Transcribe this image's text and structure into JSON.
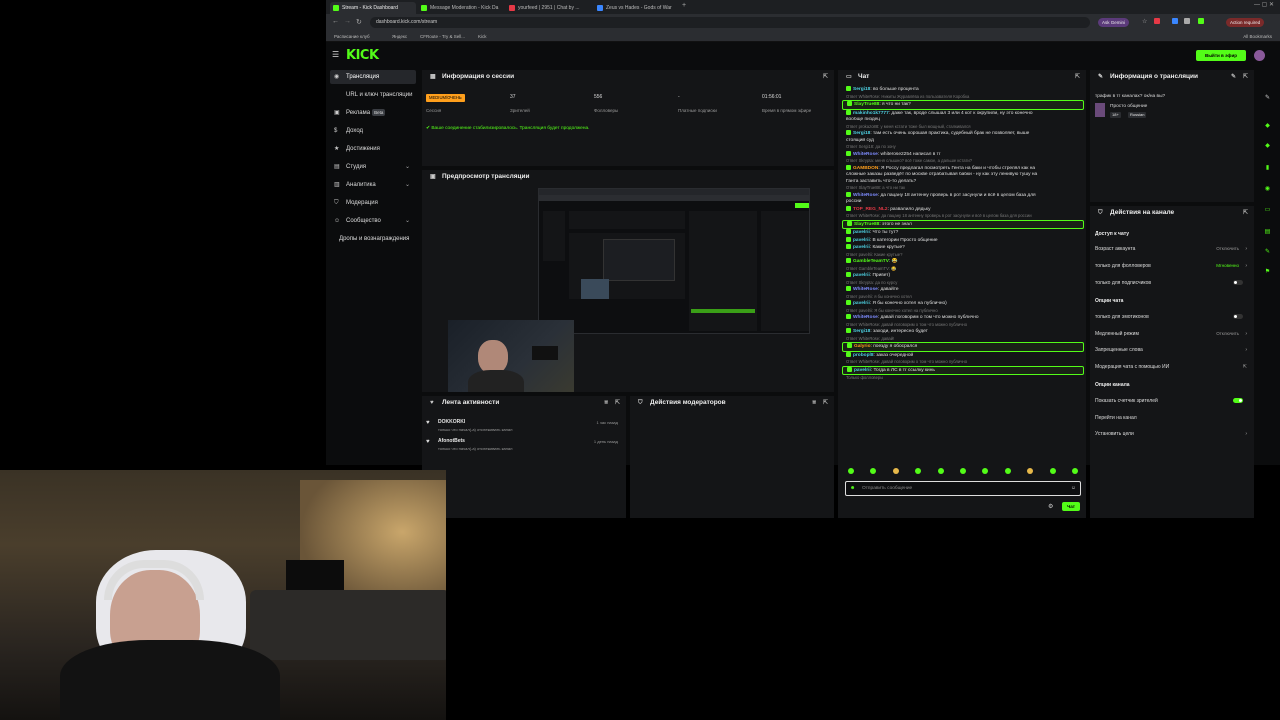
{
  "browser": {
    "tabs": [
      {
        "label": "Stream - Kick Dashboard",
        "color": "#53fc18",
        "active": true
      },
      {
        "label": "Message Moderation - Kick Da",
        "color": "#53fc18",
        "active": false
      },
      {
        "label": "yourfeed | 2951 | Chat by ...",
        "color": "#e63946",
        "active": false
      },
      {
        "label": "Zeus vs Hades - Gods of War",
        "color": "#3a86ff",
        "active": false
      }
    ],
    "url": "dashboard.kick.com/stream",
    "ask_gemini": "Ask Gemini",
    "action_required": "Action required",
    "bookmarks": [
      "Расписание клуб",
      "Яндекс",
      "CFRoute - Try & Sell...",
      "Kick"
    ],
    "all_bookmarks": "All Bookmarks"
  },
  "kick": {
    "logo": "KICK",
    "go_live": "Выйти в эфир"
  },
  "sidenav": {
    "items": [
      {
        "label": "Трансляция",
        "active": true,
        "icon": "broadcast-icon"
      },
      {
        "label": "URL и ключ трансляции",
        "icon": "key-icon"
      },
      {
        "label": "Реклама",
        "badge": "Beta",
        "icon": "ad-icon"
      },
      {
        "label": "Доход",
        "icon": "money-icon"
      },
      {
        "label": "Достижения",
        "icon": "trophy-icon"
      },
      {
        "label": "Студия",
        "chevron": true,
        "icon": "studio-icon"
      },
      {
        "label": "Аналитика",
        "chevron": true,
        "icon": "analytics-icon"
      },
      {
        "label": "Модерация",
        "icon": "shield-icon"
      },
      {
        "label": "Сообщество",
        "chevron": true,
        "icon": "community-icon"
      },
      {
        "label": "Дропы и вознаграждения",
        "icon": "gift-icon"
      }
    ]
  },
  "session": {
    "title": "Информация о сессии",
    "status_badge": "MEDIUM/ОЧЕНЬ",
    "status_label": "Сессия",
    "viewers": "37",
    "viewers_label": "Зрителей",
    "followers": "556",
    "followers_label": "Фолловеры",
    "subs": "-",
    "subs_label": "Платные подписки",
    "uptime": "01:56:01",
    "uptime_label": "Время в прямом эфире",
    "notice": "Ваше соединение стабилизировалось. Трансляция будет продолжена."
  },
  "preview": {
    "title": "Предпросмотр трансляции"
  },
  "activity": {
    "title": "Лента активности",
    "items": [
      {
        "user": "DOKKORKI",
        "text": "только что начал(-а) отслеживать канал",
        "time": "1 час назад"
      },
      {
        "user": "AfonotBets",
        "text": "только что начал(-а) отслеживать канал",
        "time": "1 день назад"
      }
    ]
  },
  "mod_actions": {
    "title": "Действия модераторов"
  },
  "chat": {
    "title": "Чат",
    "messages": [
      {
        "user": "Sergi18",
        "text": "во больше процента",
        "color": "#4dd0e1"
      },
      {
        "reply": "Ответ WhiteRose: Никиты Журавлёва из пользователя Коробка"
      },
      {
        "user": "SlayTrue88",
        "text": "я что ни так?",
        "color": "#53fc18",
        "hl": true
      },
      {
        "user": "makinho1k7777",
        "text": "даже так, вроде слышал 3 или 4 кот к окрупили, ну это конечно",
        "color": "#4dd0e1"
      },
      {
        "plain": "вообще пиздец"
      },
      {
        "reply": "Ответ prokazo88: у меня кстати тоже был мощный, сталкивался"
      },
      {
        "user": "Sergi18",
        "text": "там есть очень хорошая практика, судебный брак не позволяет, выше",
        "color": "#4dd0e1"
      },
      {
        "plain": "стоящий суд"
      },
      {
        "reply": "Ответ Sergi18: да по зону"
      },
      {
        "user": "WhiteRose",
        "text": "whiterose2254 написал в тг",
        "color": "#7e8cff"
      },
      {
        "reply": "Ответ Skrypta: меня слышно? всё тоже самое, а дальше кстати?"
      },
      {
        "user": "GAMBDON",
        "text": "Я Россу предлагал посмотреть Гента на баки и чтобы стрелял как на",
        "color": "#ff9f1c"
      },
      {
        "plain": "сложные заказы разведёт по москве отрабатывая бабки - ну как эту ленивую тушу на"
      },
      {
        "plain": "Ганта заставить что-то делать?"
      },
      {
        "reply": "Ответ SlayTrue88: а что ни так"
      },
      {
        "user": "WhiteRose",
        "text": "да пацану 18 антенну проверь в рот засунули и всё в целом база для",
        "color": "#7e8cff"
      },
      {
        "plain": "россии"
      },
      {
        "user": "TOP_REG_NL2",
        "text": "развалило дядьку",
        "color": "#e63946"
      },
      {
        "reply": "Ответ WhiteRose: да пацану 18 антенну проверь в рот засунули и всё в целом база для россии"
      },
      {
        "user": "SlayTrue88",
        "text": "этого не знал",
        "color": "#53fc18",
        "hl": true
      },
      {
        "user": "pavelrii",
        "text": "Что ты тут?",
        "color": "#4dd0e1"
      },
      {
        "user": "pavelrii",
        "text": "В категории Просто общение",
        "color": "#4dd0e1"
      },
      {
        "user": "pavelrii",
        "text": "Какие крутые?",
        "color": "#4dd0e1"
      },
      {
        "reply": "Ответ pavelrii: Какие крутые?"
      },
      {
        "user": "GambleTeamTV",
        "text": "😂",
        "color": "#53fc18"
      },
      {
        "reply": "Ответ GambleTeamTV: 😂"
      },
      {
        "user": "pavelrii",
        "text": "Привет)",
        "color": "#4dd0e1"
      },
      {
        "reply": "Ответ Skrypta: да по курсу"
      },
      {
        "user": "WhiteRose",
        "text": "давайте",
        "color": "#7e8cff"
      },
      {
        "reply": "Ответ pavelrii: я бы конечно хотел"
      },
      {
        "user": "pavelrii",
        "text": "Я бы конечно хотел на публично)",
        "color": "#4dd0e1"
      },
      {
        "reply": "Ответ pavelrii: Я бы конечно хотел на публично"
      },
      {
        "user": "WhiteRose",
        "text": "давай поговорим о том что можно публично",
        "color": "#7e8cff"
      },
      {
        "reply": "Ответ WhiteRose: давай поговорим о том что можно публично"
      },
      {
        "user": "Sergi18",
        "text": "заходи, интересно будет",
        "color": "#4dd0e1"
      },
      {
        "reply": "Ответ WhiteRose: давай!"
      },
      {
        "user": "Galyrio",
        "text": "поезду я обосрался",
        "color": "#ff9f1c",
        "hl": true
      },
      {
        "user": "probopl8",
        "text": "заказ очередной",
        "color": "#4dd0e1"
      },
      {
        "reply": "Ответ WhiteRose: давай поговорим о том что можно публично"
      },
      {
        "user": "pavelrii",
        "text": "Тогда в ЛС в тг ссылку кинь",
        "color": "#4dd0e1",
        "hl": true
      },
      {
        "reply": "Только фолловеры"
      }
    ],
    "input_placeholder": "Отправить сообщение",
    "send_label": "Чат"
  },
  "stream_info": {
    "title": "Информация о трансляции",
    "stream_title": "трафик в тг каналах? ок/на вы?",
    "category": "Просто общение",
    "tags": [
      "18+",
      "Russian"
    ]
  },
  "channel_actions": {
    "title": "Действия на канале",
    "chat_access": "Доступ к чату",
    "rows": [
      {
        "label": "Возраст аккаунта",
        "value": "Отключить",
        "type": "chevron"
      },
      {
        "label": "только для фолловеров",
        "value": "Мгновенно",
        "type": "chevron",
        "green": true
      },
      {
        "label": "только для подписчиков",
        "type": "toggle",
        "on": false
      }
    ],
    "chat_options": "Опции чата",
    "rows2": [
      {
        "label": "только для эмотиконов",
        "type": "toggle",
        "on": false
      },
      {
        "label": "Медленный режим",
        "value": "Отключить",
        "type": "chevron"
      },
      {
        "label": "Запрещенные слова",
        "type": "chevron"
      },
      {
        "label": "Модерация чата с помощью ИИ",
        "type": "ext"
      }
    ],
    "channel_options": "Опции канала",
    "rows3": [
      {
        "label": "Показать счетчик зрителей",
        "type": "toggle",
        "on": true
      },
      {
        "label": "Перейти на канал",
        "type": "none"
      },
      {
        "label": "Установить цели",
        "type": "chevron"
      }
    ]
  },
  "colors": {
    "accent": "#53fc18",
    "panel": "#141517",
    "bg": "#0b0c0d"
  }
}
